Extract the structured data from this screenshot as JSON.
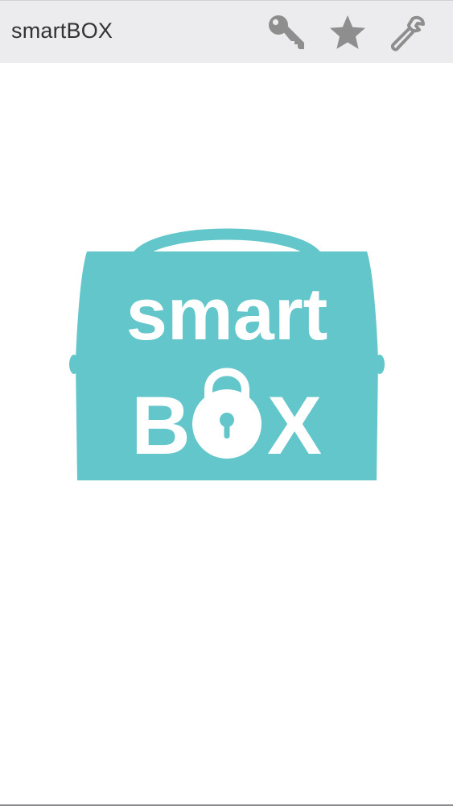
{
  "app": {
    "title": "smartBOX"
  },
  "toolbar": {
    "buttons": [
      {
        "id": "keys",
        "icon": "key-icon"
      },
      {
        "id": "favorites",
        "icon": "star-icon"
      },
      {
        "id": "settings",
        "icon": "wrench-icon"
      }
    ],
    "icon_color": "#8e8e8e"
  },
  "logo": {
    "line1": "smart",
    "line2_start": "B",
    "line2_end": "X",
    "lock_icon": "padlock-icon",
    "color": "#62c6cb"
  }
}
